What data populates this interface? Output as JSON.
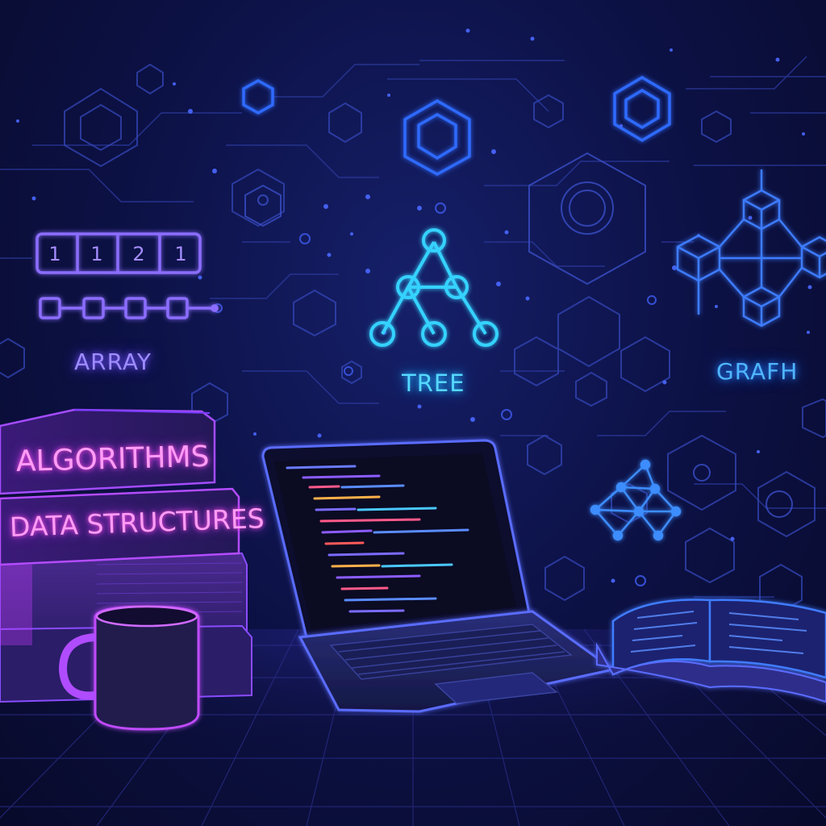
{
  "labels": {
    "array": "ARRAY",
    "tree": "TREE",
    "graph": "GRAFH"
  },
  "array_cells": [
    "1",
    "1",
    "2",
    "1"
  ],
  "books": {
    "top": "ALGORITHMS",
    "middle": "DATA STRUCTURES"
  },
  "colors": {
    "background": "#0a0b2a",
    "neon_purple": "#9d8bff",
    "neon_cyan": "#55d8ff",
    "neon_blue": "#4fb5ff",
    "neon_pink": "#ff9cf5"
  }
}
